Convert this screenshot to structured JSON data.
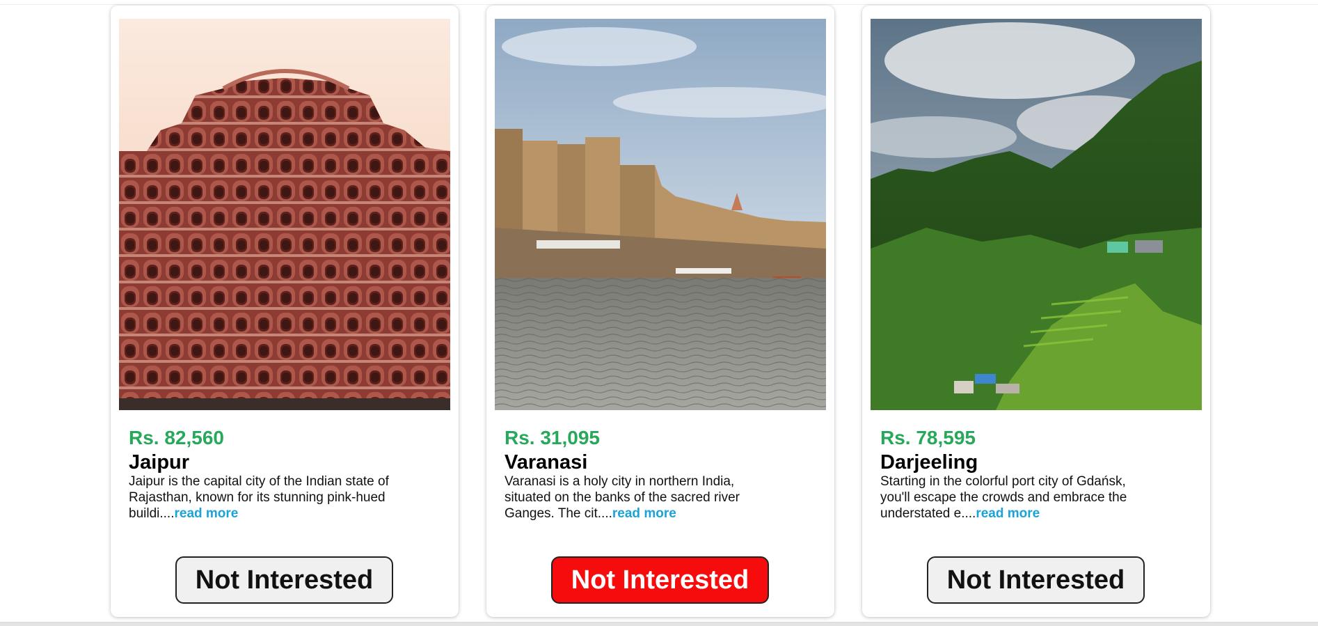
{
  "colors": {
    "price": "#27a85a",
    "read_more": "#1aa3d9",
    "button_default_bg": "#f0f0f0",
    "button_active_bg": "#f60c0c"
  },
  "cards": [
    {
      "image_alt": "Hawa Mahal pink sandstone facade",
      "price": "Rs. 82,560",
      "name": "Jaipur",
      "description": "Jaipur is the capital city of the Indian state of Rajasthan, known for its stunning pink-hued buildi....",
      "read_more": "read more",
      "button": "Not Interested",
      "button_active": false
    },
    {
      "image_alt": "Varanasi ghats along the Ganges river",
      "price": "Rs. 31,095",
      "name": "Varanasi",
      "description": "Varanasi is a holy city in northern India, situated on the banks of the sacred river Ganges. The cit....",
      "read_more": "read more",
      "button": "Not Interested",
      "button_active": true
    },
    {
      "image_alt": "Green hills of Darjeeling under mist",
      "price": "Rs. 78,595",
      "name": "Darjeeling",
      "description": "Starting in the colorful port city of Gdańsk, you'll escape the crowds and embrace the understated e....",
      "read_more": "read more",
      "button": "Not Interested",
      "button_active": false
    }
  ]
}
